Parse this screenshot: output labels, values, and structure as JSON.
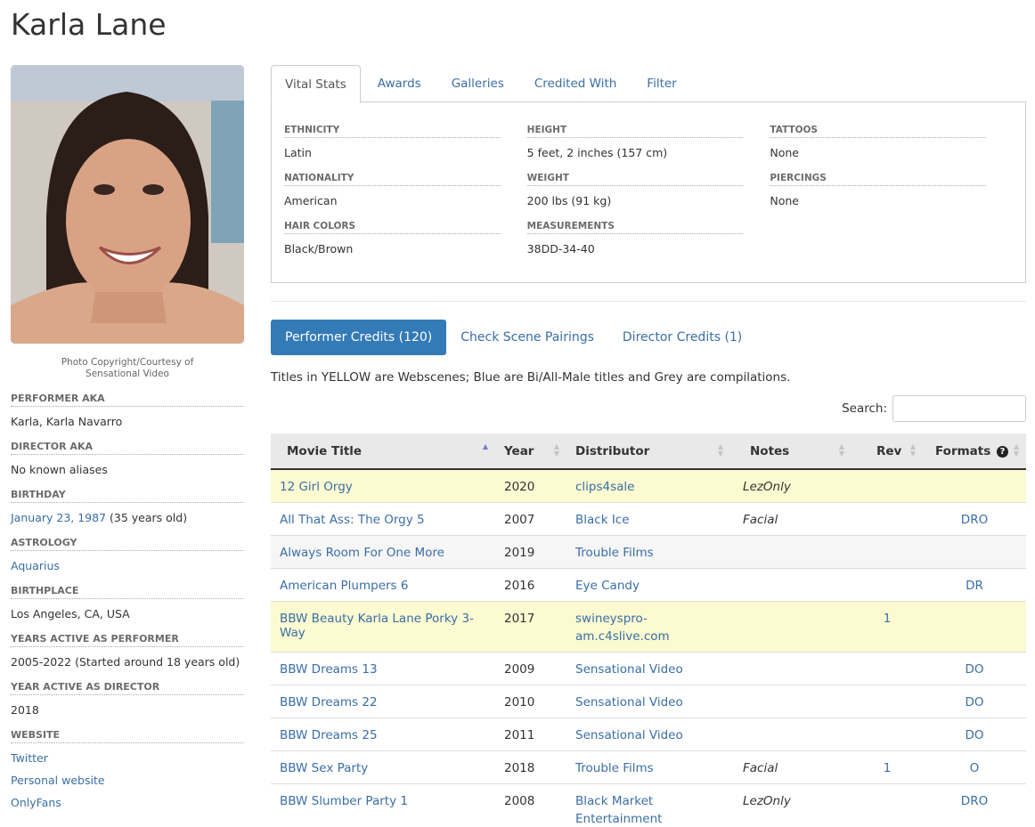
{
  "performer": {
    "name": "Karla Lane"
  },
  "photo": {
    "caption_line1": "Photo Copyright/Courtesy of",
    "caption_line2": "Sensational Video"
  },
  "bio": {
    "performer_aka": {
      "label": "Performer AKA",
      "value": "Karla, Karla Navarro"
    },
    "director_aka": {
      "label": "Director AKA",
      "value": "No known aliases"
    },
    "birthday": {
      "label": "Birthday",
      "date": "January 23, 1987",
      "age": " (35 years old)"
    },
    "astrology": {
      "label": "Astrology",
      "value": "Aquarius"
    },
    "birthplace": {
      "label": "Birthplace",
      "value": "Los Angeles, CA, USA"
    },
    "years_active": {
      "label": "Years Active as Performer",
      "value": "2005-2022 (Started around 18 years old)"
    },
    "year_active_director": {
      "label": "Year Active as Director",
      "value": "2018"
    },
    "website": {
      "label": "Website",
      "links": [
        "Twitter",
        "Personal website",
        "OnlyFans"
      ]
    }
  },
  "tabs": [
    "Vital Stats",
    "Awards",
    "Galleries",
    "Credited With",
    "Filter"
  ],
  "vitals": {
    "ethnicity": {
      "label": "Ethnicity",
      "value": "Latin"
    },
    "nationality": {
      "label": "Nationality",
      "value": "American"
    },
    "hair": {
      "label": "Hair Colors",
      "value": "Black/Brown"
    },
    "height": {
      "label": "Height",
      "value": "5 feet, 2 inches (157 cm)"
    },
    "weight": {
      "label": "Weight",
      "value": "200 lbs (91 kg)"
    },
    "measurements": {
      "label": "Measurements",
      "value": "38DD-34-40"
    },
    "tattoos": {
      "label": "Tattoos",
      "value": "None"
    },
    "piercings": {
      "label": "Piercings",
      "value": "None"
    }
  },
  "credit_tabs": [
    "Performer Credits (120)",
    "Check Scene Pairings",
    "Director Credits (1)"
  ],
  "legend_note": "Titles in YELLOW are Webscenes; Blue are Bi/All-Male titles and Grey are compilations.",
  "search": {
    "label": "Search:",
    "value": ""
  },
  "table": {
    "columns": [
      "Movie Title",
      "Year",
      "Distributor",
      "Notes",
      "Rev",
      "Formats"
    ],
    "rows": [
      {
        "title": "12 Girl Orgy",
        "year": "2020",
        "dist1": "clips4sale",
        "dist2": "",
        "notes": "LezOnly",
        "rev": "",
        "formats": ""
      },
      {
        "title": "All That Ass: The Orgy 5",
        "year": "2007",
        "dist1": "Black Ice",
        "dist2": "",
        "notes": "Facial",
        "rev": "",
        "formats": "DRO"
      },
      {
        "title": "Always Room For One More",
        "year": "2019",
        "dist1": "Trouble Films",
        "dist2": "",
        "notes": "",
        "rev": "",
        "formats": ""
      },
      {
        "title": "American Plumpers 6",
        "year": "2016",
        "dist1": "Eye Candy",
        "dist2": "",
        "notes": "",
        "rev": "",
        "formats": "DR"
      },
      {
        "title": "BBW Beauty Karla Lane Porky 3-Way",
        "year": "2017",
        "dist1": "swineyspro-",
        "dist2": "am.c4slive.com",
        "notes": "",
        "rev": "1",
        "formats": ""
      },
      {
        "title": "BBW Dreams 13",
        "year": "2009",
        "dist1": "Sensational Video",
        "dist2": "",
        "notes": "",
        "rev": "",
        "formats": "DO"
      },
      {
        "title": "BBW Dreams 22",
        "year": "2010",
        "dist1": "Sensational Video",
        "dist2": "",
        "notes": "",
        "rev": "",
        "formats": "DO"
      },
      {
        "title": "BBW Dreams 25",
        "year": "2011",
        "dist1": "Sensational Video",
        "dist2": "",
        "notes": "",
        "rev": "",
        "formats": "DO"
      },
      {
        "title": "BBW Sex Party",
        "year": "2018",
        "dist1": "Trouble Films",
        "dist2": "",
        "notes": "Facial",
        "rev": "1",
        "formats": "O"
      },
      {
        "title": "BBW Slumber Party 1",
        "year": "2008",
        "dist1": "Black Market",
        "dist2": "Entertainment",
        "notes": "LezOnly",
        "rev": "",
        "formats": "DRO"
      }
    ]
  }
}
